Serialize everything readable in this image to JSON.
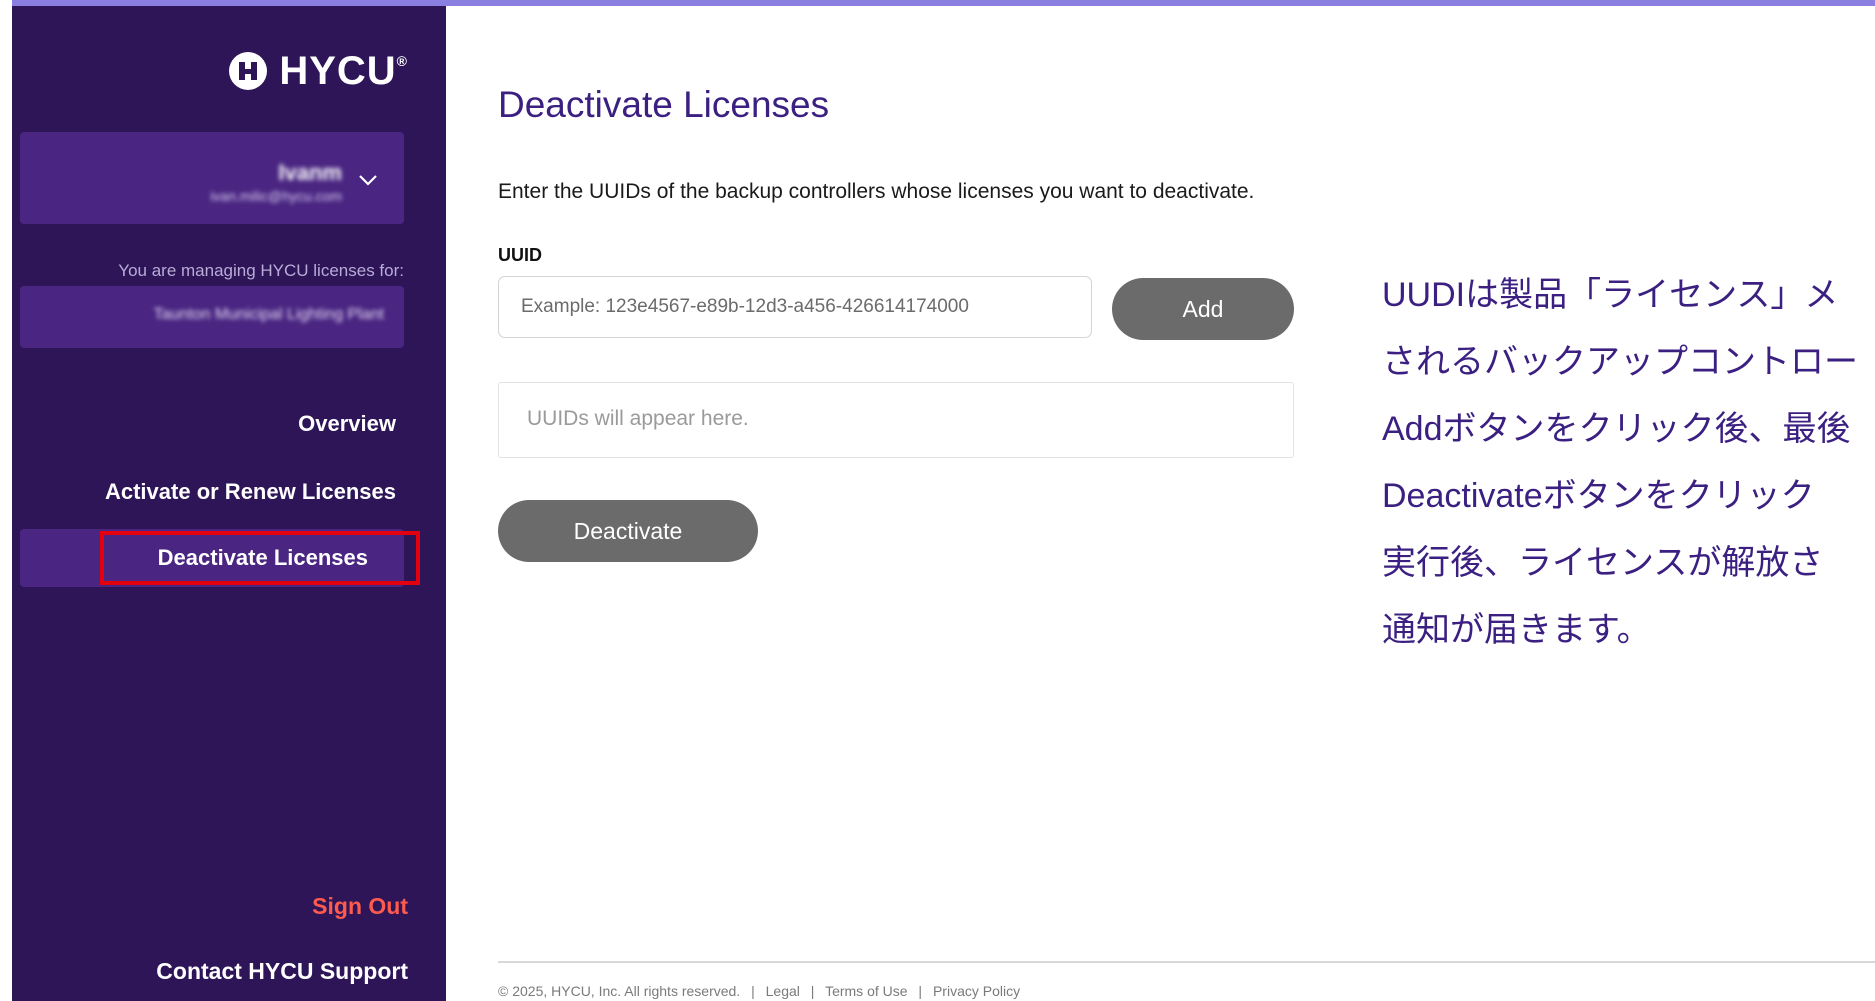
{
  "brand": {
    "name": "HYCU",
    "trademark": "®"
  },
  "user": {
    "name": "Ivanm",
    "email": "ivan.milic@hycu.com"
  },
  "account": {
    "managing_label": "You are managing HYCU licenses for:",
    "org_name": "Taunton Municipal Lighting Plant"
  },
  "nav": {
    "overview": "Overview",
    "activate": "Activate or Renew Licenses",
    "deactivate": "Deactivate Licenses"
  },
  "sidebar_bottom": {
    "sign_out": "Sign Out",
    "support": "Contact HYCU Support"
  },
  "main": {
    "title": "Deactivate Licenses",
    "intro": "Enter the UUIDs of the backup controllers whose licenses you want to deactivate.",
    "uuid_label": "UUID",
    "uuid_placeholder": "Example: 123e4567-e89b-12d3-a456-426614174000",
    "uuid_value": "",
    "add_label": "Add",
    "list_placeholder": "UUIDs will appear here.",
    "deactivate_label": "Deactivate"
  },
  "note_lines": [
    "UUDIは製品「ライセンス」メ",
    "されるバックアップコントロー",
    "Addボタンをクリック後、最後",
    "Deactivateボタンをクリック",
    "実行後、ライセンスが解放さ",
    "通知が届きます。"
  ],
  "footer": {
    "copyright": "© 2025, HYCU, Inc. All rights reserved.",
    "legal": "Legal",
    "terms": "Terms of Use",
    "privacy": "Privacy Policy",
    "separator": "|"
  },
  "colors": {
    "sidebar_bg": "#2d1558",
    "card_bg": "#4a2682",
    "title_purple": "#3b2082",
    "button_gray": "#6b6b6b",
    "sign_out_red": "#ff5a4e",
    "highlight_red": "#e3000f"
  }
}
